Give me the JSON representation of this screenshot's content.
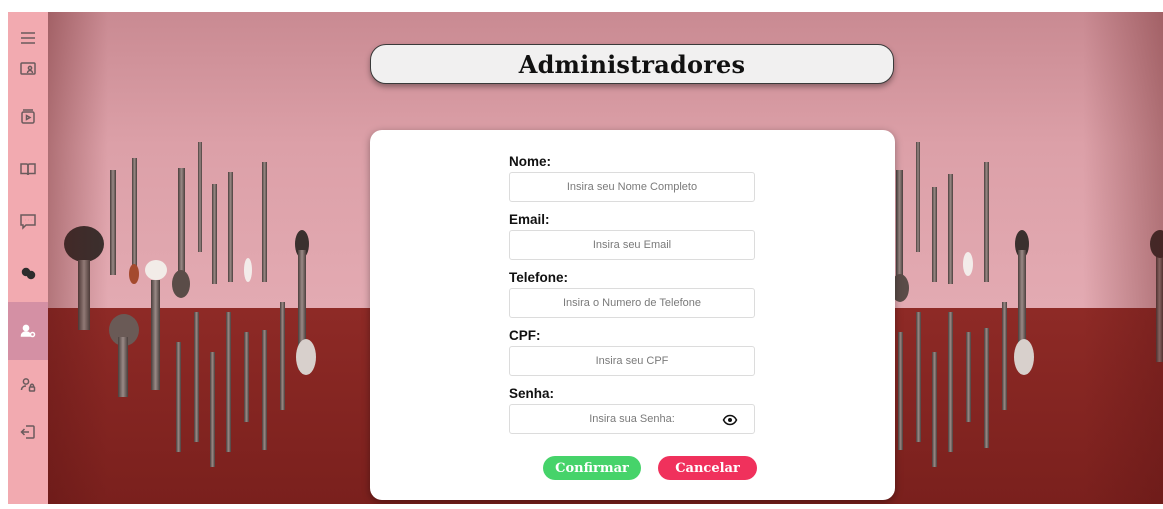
{
  "sidebar": {
    "items": [
      {
        "icon": "menu-icon"
      },
      {
        "icon": "screen-user-icon"
      },
      {
        "icon": "media-icon"
      },
      {
        "icon": "book-icon"
      },
      {
        "icon": "chat-icon"
      },
      {
        "icon": "palette-icon"
      },
      {
        "icon": "admin-user-icon",
        "active": true
      },
      {
        "icon": "user-lock-icon"
      },
      {
        "icon": "logout-icon"
      }
    ]
  },
  "header": {
    "title": "Administradores"
  },
  "form": {
    "fields": [
      {
        "label": "Nome:",
        "placeholder": "Insira seu Nome Completo"
      },
      {
        "label": "Email:",
        "placeholder": "Insira seu Email"
      },
      {
        "label": "Telefone:",
        "placeholder": "Insira o Numero de Telefone"
      },
      {
        "label": "CPF:",
        "placeholder": "Insira seu CPF"
      },
      {
        "label": "Senha:",
        "placeholder": "Insira sua Senha:"
      }
    ],
    "confirm_label": "Confirmar",
    "cancel_label": "Cancelar"
  },
  "colors": {
    "sidebar": "#f2aab0",
    "sidebar_active": "#d490a4",
    "confirm": "#46d36a",
    "cancel": "#f0315c"
  }
}
